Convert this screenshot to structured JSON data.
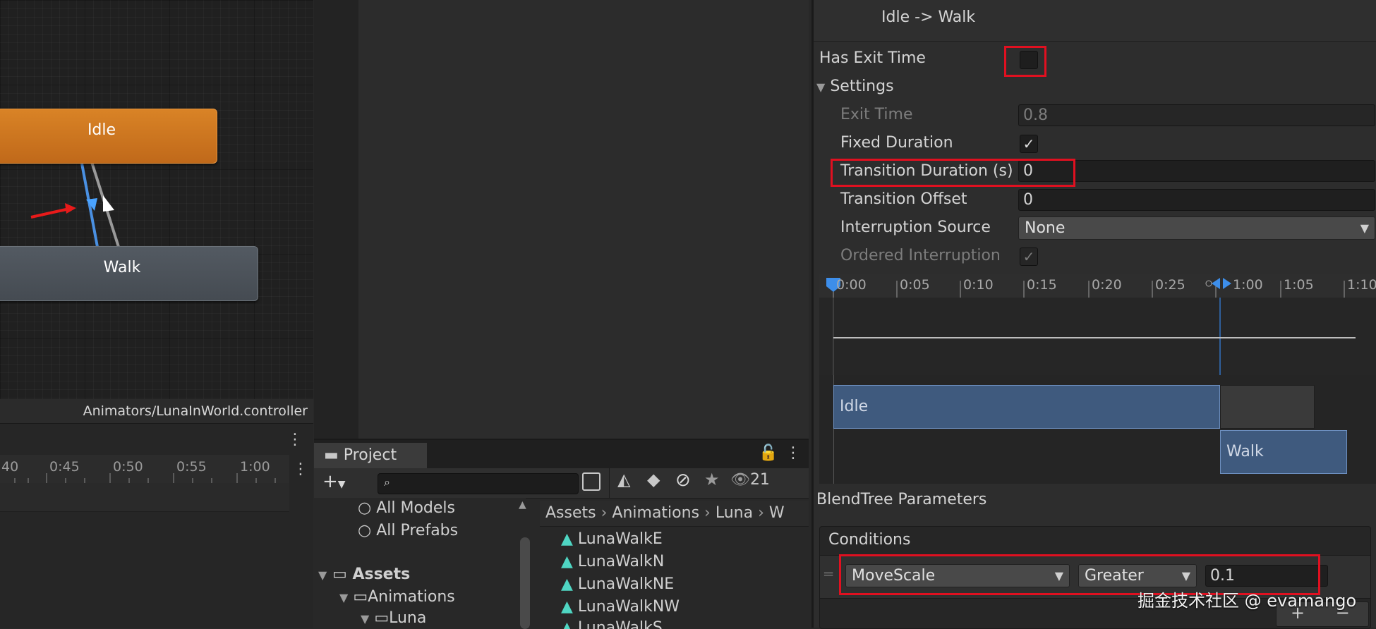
{
  "graph": {
    "states": [
      "Idle",
      "Walk"
    ],
    "path": "Animators/LunaInWorld.controller"
  },
  "left_timeline": {
    "ticks": [
      "40",
      "0:45",
      "0:50",
      "0:55",
      "1:00"
    ]
  },
  "project": {
    "tab_label": "Project",
    "hidden_count": "21",
    "tree": [
      "All Models",
      "All Prefabs",
      "Assets",
      "Animations",
      "Luna"
    ],
    "breadcrumb": [
      "Assets",
      "Animations",
      "Luna",
      "W"
    ],
    "assets": [
      "LunaWalkE",
      "LunaWalkN",
      "LunaWalkNE",
      "LunaWalkNW",
      "LunaWalkS"
    ]
  },
  "inspector": {
    "title": "Idle -> Walk",
    "has_exit_time_label": "Has Exit Time",
    "has_exit_time": false,
    "settings_label": "Settings",
    "exit_time_label": "Exit Time",
    "exit_time_value": "0.8",
    "fixed_duration_label": "Fixed Duration",
    "fixed_duration": true,
    "transition_duration_label": "Transition Duration (s)",
    "transition_duration_value": "0",
    "transition_offset_label": "Transition Offset",
    "transition_offset_value": "0",
    "interruption_source_label": "Interruption Source",
    "interruption_source_value": "None",
    "ordered_interruption_label": "Ordered Interruption",
    "timeline_ticks": [
      "0:00",
      "0:05",
      "0:10",
      "0:15",
      "0:20",
      "0:25",
      "1:00",
      "1:05",
      "1:10"
    ],
    "clip_from": "Idle",
    "clip_to": "Walk",
    "blendtree_label": "BlendTree Parameters",
    "conditions_label": "Conditions",
    "condition_param": "MoveScale",
    "condition_op": "Greater",
    "condition_value": "0.1"
  },
  "watermark": "掘金技术社区 @ evamango",
  "colors": {
    "idle_state": "#d07a22",
    "walk_state": "#4c535a",
    "highlight": "#e01020",
    "clip": "#3f5a7e"
  }
}
